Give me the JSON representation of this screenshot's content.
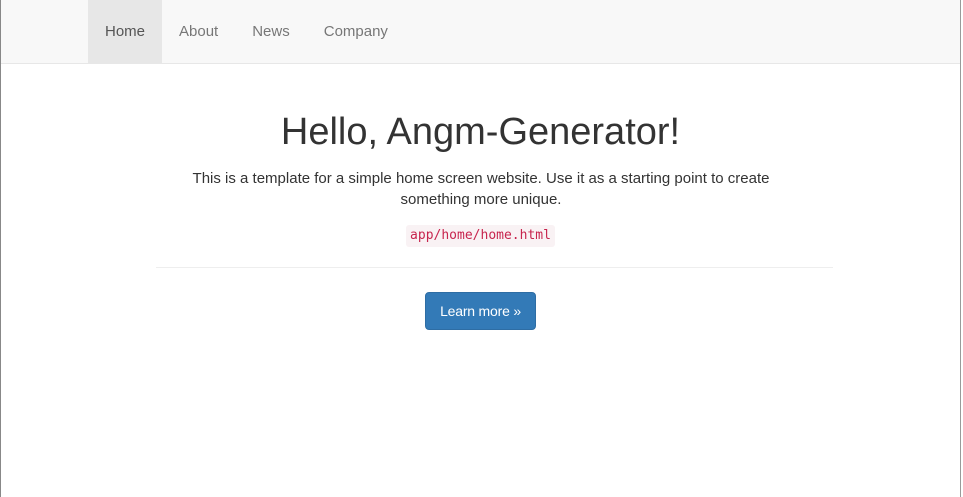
{
  "nav": {
    "items": [
      {
        "label": "Home",
        "active": true
      },
      {
        "label": "About",
        "active": false
      },
      {
        "label": "News",
        "active": false
      },
      {
        "label": "Company",
        "active": false
      }
    ]
  },
  "hero": {
    "title": "Hello, Angm-Generator!",
    "lead": "This is a template for a simple home screen website. Use it as a starting point to create something more unique.",
    "code_path": "app/home/home.html",
    "button_label": "Learn more »"
  },
  "colors": {
    "navbar_bg": "#f8f8f8",
    "active_nav_bg": "#e7e7e7",
    "primary": "#337ab7",
    "code_text": "#c7254e",
    "code_bg": "#f9f2f4"
  }
}
